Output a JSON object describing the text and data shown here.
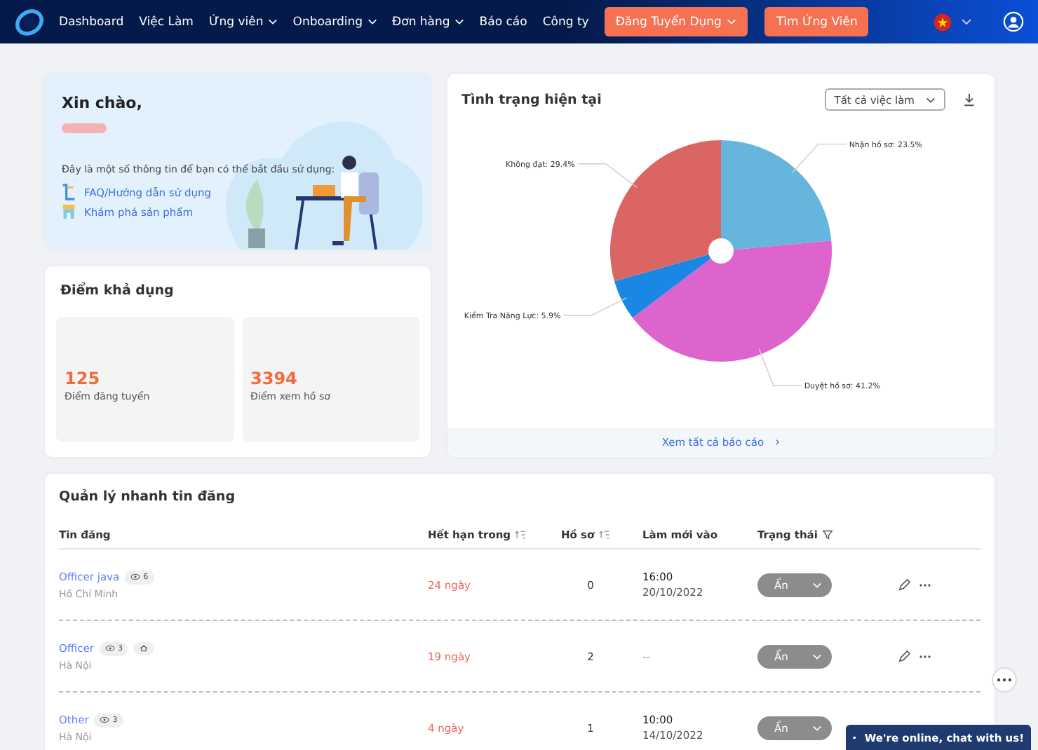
{
  "nav": {
    "items": [
      {
        "label": "Dashboard",
        "dropdown": false
      },
      {
        "label": "Việc Làm",
        "dropdown": false
      },
      {
        "label": "Ứng viên",
        "dropdown": true
      },
      {
        "label": "Onboarding",
        "dropdown": true
      },
      {
        "label": "Đơn hàng",
        "dropdown": true
      },
      {
        "label": "Báo cáo",
        "dropdown": false
      },
      {
        "label": "Công ty",
        "dropdown": false
      }
    ],
    "buttons": [
      {
        "label": "Đăng Tuyển Dụng",
        "dropdown": true
      },
      {
        "label": "Tìm Ứng Viên",
        "dropdown": false
      }
    ]
  },
  "greeting": {
    "title": "Xin chào,",
    "intro": "Đây là một số thông tin để bạn có thể bắt đầu sử dụng:",
    "links": [
      {
        "label": "FAQ/Hướng dẫn sử dụng",
        "kind": "guide"
      },
      {
        "label": "Khám phá sản phẩm",
        "kind": "shop"
      }
    ]
  },
  "points": {
    "title": "Điểm khả dụng",
    "cards": [
      {
        "value": "125",
        "label": "Điểm đăng tuyển"
      },
      {
        "value": "3394",
        "label": "Điểm xem hồ sơ"
      }
    ]
  },
  "status": {
    "title": "Tình trạng hiện tại",
    "filter": "Tất cả việc làm",
    "footer_link": "Xem tất cả báo cáo",
    "footer_arrow": "›",
    "chart_data": {
      "type": "pie",
      "values": [
        23.5,
        41.2,
        5.9,
        29.4
      ],
      "colors": [
        "#65b5dc",
        "#dc64cc",
        "#1a87e4",
        "#db6563"
      ],
      "value_labels": [
        "Nhận hồ sơ: 23.5%",
        "Duyệt hồ sơ: 41.2%",
        "Kiểm Tra Năng Lực: 5.9%",
        "Không đạt: 29.4%"
      ]
    }
  },
  "jobs": {
    "title": "Quản lý nhanh tin đăng",
    "columns": [
      {
        "label": "Tin đăng",
        "kind": "plain"
      },
      {
        "label": "Hết hạn trong",
        "kind": "sortable"
      },
      {
        "label": "Hồ sơ",
        "kind": "sortable"
      },
      {
        "label": "Làm mới vào",
        "kind": "plain"
      },
      {
        "label": "Trạng thái",
        "kind": "filterable"
      }
    ],
    "rows": [
      {
        "title": "Officer java",
        "views": "6",
        "home_badge": false,
        "location": "Hồ Chí Minh",
        "expires": "24 ngày",
        "applications": "0",
        "refreshed_time": "16:00",
        "refreshed_date": "20/10/2022",
        "status": "Ẩn",
        "actions": true
      },
      {
        "title": "Officer",
        "views": "3",
        "home_badge": true,
        "location": "Hà Nội",
        "expires": "19 ngày",
        "applications": "2",
        "refreshed_time": "--",
        "status": "Ẩn",
        "actions": true
      },
      {
        "title": "Other",
        "views": "3",
        "home_badge": false,
        "location": "Hà Nội",
        "expires": "4 ngày",
        "applications": "1",
        "refreshed_time": "10:00",
        "refreshed_date": "14/10/2022",
        "status": "Ẩn",
        "actions": false
      }
    ]
  },
  "chat": {
    "label": "We're online, chat with us!"
  }
}
